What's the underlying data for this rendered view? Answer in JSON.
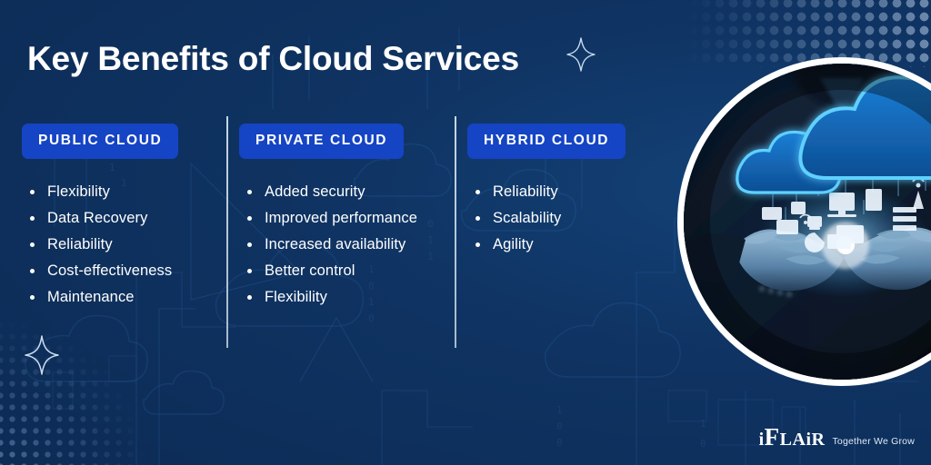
{
  "header": {
    "title": "Key Benefits of Cloud Services"
  },
  "colors": {
    "background": "#0f3362",
    "badge": "#1544c4",
    "text": "#ffffff",
    "divider": "#e2ecf7",
    "accent_glow": "#1e9bff"
  },
  "columns": [
    {
      "badge_label": "PUBLIC CLOUD",
      "items": [
        "Flexibility",
        "Data Recovery",
        "Reliability",
        "Cost-effectiveness",
        "Maintenance"
      ]
    },
    {
      "badge_label": "PRIVATE CLOUD",
      "items": [
        "Added security",
        "Improved performance",
        "Increased availability",
        "Better control",
        "Flexibility"
      ]
    },
    {
      "badge_label": "HYBRID CLOUD",
      "items": [
        "Reliability",
        "Scalability",
        "Agility"
      ]
    }
  ],
  "photo": {
    "alt": "Hands holding a glowing cloud network with connected device icons"
  },
  "logo": {
    "mark_i": "i",
    "mark_f": "F",
    "mark_l": "L",
    "mark_a": "A",
    "mark_i2": "i",
    "mark_r": "R",
    "full_name": "iFLAiR",
    "tagline": "Together We Grow"
  },
  "decor": {
    "sparkle_top": "sparkle-icon",
    "sparkle_bottom": "sparkle-icon",
    "dots_top_right": "halftone-dot-pattern",
    "dots_bottom_left": "halftone-dot-pattern"
  }
}
